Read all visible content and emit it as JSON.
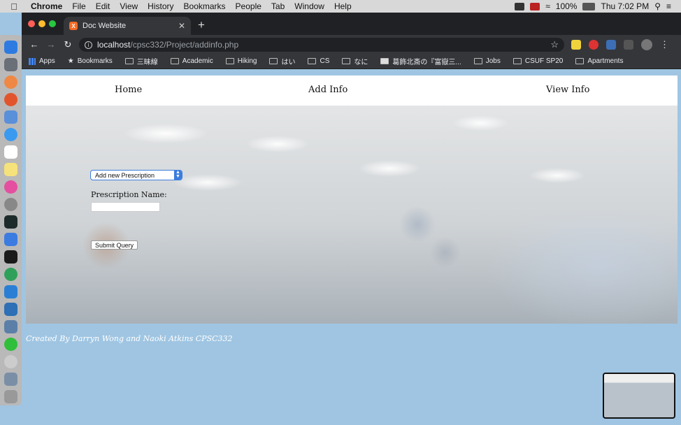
{
  "menubar": {
    "app": "Chrome",
    "items": [
      "File",
      "Edit",
      "View",
      "History",
      "Bookmarks",
      "People",
      "Tab",
      "Window",
      "Help"
    ],
    "battery": "100%",
    "clock": "Thu 7:02 PM"
  },
  "tab": {
    "title": "Doc Website",
    "favicon": "xampp-icon"
  },
  "omnibox": {
    "host": "localhost",
    "path": "/cpsc332/Project/addinfo.php"
  },
  "bookmarks": [
    {
      "label": "Apps",
      "icon": "apps-grid-icon"
    },
    {
      "label": "Bookmarks",
      "icon": "star-icon"
    },
    {
      "label": "三昧線",
      "icon": "folder-icon"
    },
    {
      "label": "Academic",
      "icon": "folder-icon"
    },
    {
      "label": "Hiking",
      "icon": "folder-icon"
    },
    {
      "label": "はい",
      "icon": "folder-icon"
    },
    {
      "label": "CS",
      "icon": "folder-icon"
    },
    {
      "label": "なに",
      "icon": "folder-icon"
    },
    {
      "label": "葛飾北斎の『富嶽三...",
      "icon": "page-icon"
    },
    {
      "label": "Jobs",
      "icon": "folder-icon"
    },
    {
      "label": "CSUF SP20",
      "icon": "folder-icon"
    },
    {
      "label": "Apartments",
      "icon": "folder-icon"
    }
  ],
  "site": {
    "nav": {
      "home": "Home",
      "add_info": "Add Info",
      "view_info": "View Info"
    },
    "form": {
      "select_value": "Add new Prescription",
      "label": "Prescription Name:",
      "input_value": "",
      "submit": "Submit Query"
    },
    "footer": "Created By Darryn Wong and Naoki Atkins CPSC332"
  },
  "colors": {
    "page_background": "#9fc5e2",
    "select_accent": "#3b7ddd"
  }
}
